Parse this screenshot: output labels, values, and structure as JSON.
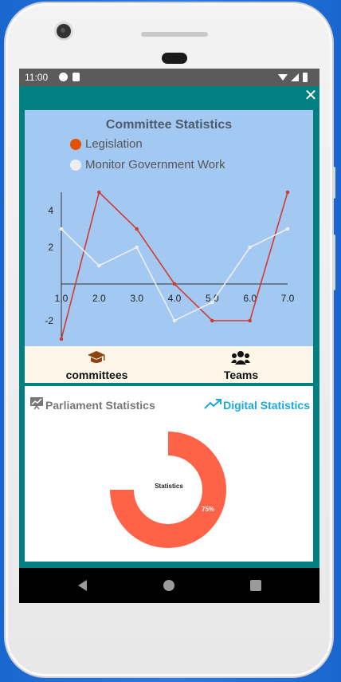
{
  "status_bar": {
    "time": "11:00"
  },
  "app": {
    "close_icon": "close-icon",
    "chart_data": {
      "type": "line",
      "title": "Committee Statistics",
      "x": [
        1.0,
        2.0,
        3.0,
        4.0,
        5.0,
        6.0,
        7.0
      ],
      "x_tick_labels": [
        "1.0",
        "2.0",
        "3.0",
        "4.0",
        "5.0",
        "6.0",
        "7.0"
      ],
      "y_tick_labels": [
        "4",
        "2",
        "-2"
      ],
      "ylim": [
        -3,
        5
      ],
      "xlim": [
        1,
        7
      ],
      "grid": false,
      "legend_position": "top",
      "series": [
        {
          "name": "Legislation",
          "color": "#e65100",
          "line_color": "#d43a33",
          "values": [
            -3,
            5,
            3,
            0,
            -2,
            -2,
            5
          ]
        },
        {
          "name": "Monitor Government Work",
          "color": "#eeeeee",
          "line_color": "#eeeeee",
          "values": [
            3,
            1,
            2,
            -2,
            -1,
            2,
            3
          ]
        }
      ]
    },
    "tabs": [
      {
        "label": "committees",
        "icon": "graduation-cap-icon"
      },
      {
        "label": "Teams",
        "icon": "users-icon"
      }
    ],
    "stats": {
      "left_label": "Parliament Statistics",
      "left_icon": "presentation-chart-icon",
      "right_label": "Digital Statistics",
      "right_icon": "trending-up-icon",
      "donut": {
        "center_label": "Statistics",
        "percent_label": "75%",
        "percent": 75,
        "color": "#ff6347"
      }
    }
  },
  "nav": {
    "back": "back-triangle-icon",
    "home": "home-circle-icon",
    "recents": "recents-square-icon"
  }
}
